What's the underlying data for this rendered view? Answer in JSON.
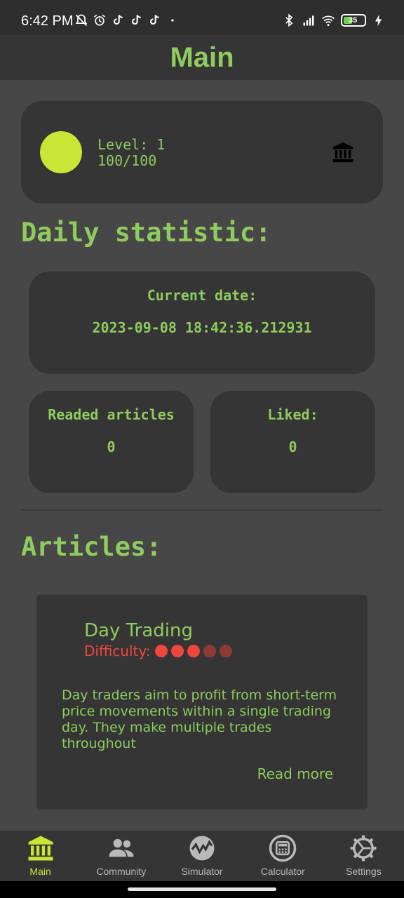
{
  "status_bar": {
    "time": "6:42 PM",
    "battery": "35",
    "left_icons": [
      "bell-off-icon",
      "alarm-icon",
      "tiktok-icon",
      "tiktok-icon",
      "tiktok-icon",
      "dot-icon"
    ],
    "right_icons": [
      "bluetooth-icon",
      "signal-icon",
      "wifi-icon",
      "battery-icon",
      "charging-icon"
    ]
  },
  "app_bar": {
    "title": "Main"
  },
  "level_card": {
    "level_text": "Level: 1",
    "progress_text": "100/100",
    "dot_color": "#c9e637",
    "icon": "bank-icon"
  },
  "daily": {
    "title": "Daily statistic:",
    "current_date_label": "Current date:",
    "current_date_value": "2023-09-08 18:42:36.212931",
    "readed_label": "Readed articles",
    "readed_value": "0",
    "liked_label": "Liked:",
    "liked_value": "0"
  },
  "articles": {
    "title": "Articles:",
    "items": [
      {
        "title": "Day Trading",
        "difficulty_label": "Difficulty:",
        "difficulty_level": 3,
        "difficulty_max": 5,
        "description": "Day traders aim to profit from short-term price movements within a single trading day. They make multiple trades throughout",
        "read_more": "Read more"
      }
    ]
  },
  "bottom_nav": {
    "items": [
      {
        "label": "Main",
        "icon": "bank-icon",
        "active": true
      },
      {
        "label": "Community",
        "icon": "people-icon",
        "active": false
      },
      {
        "label": "Simulator",
        "icon": "chart-wave-icon",
        "active": false
      },
      {
        "label": "Calculator",
        "icon": "calculator-icon",
        "active": false
      },
      {
        "label": "Settings",
        "icon": "gear-icon",
        "active": false
      }
    ]
  },
  "colors": {
    "accent_green": "#8fcb5e",
    "lime": "#c9e637",
    "difficulty_red": "#f0463c",
    "card_bg": "#353535",
    "page_bg": "#474747"
  }
}
